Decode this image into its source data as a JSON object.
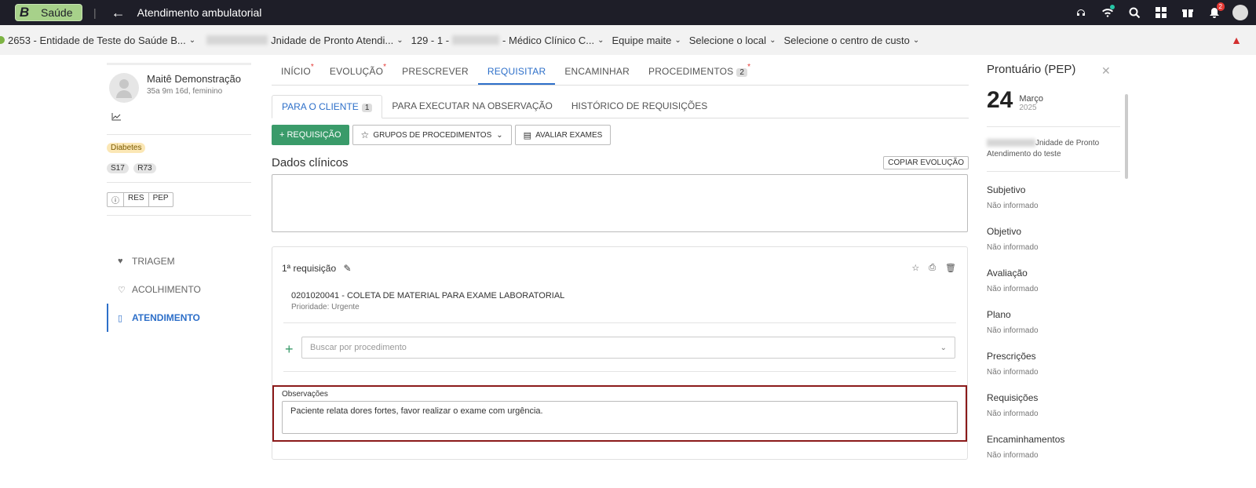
{
  "topbar": {
    "brand_letter": "B",
    "brand_name": "Saúde",
    "separator": "|",
    "title": "Atendimento ambulatorial",
    "notifications_count": "2"
  },
  "context": {
    "entity": "2653 - Entidade de Teste do Saúde B...",
    "unit": "Jnidade de Pronto Atendi...",
    "professional_prefix": "129 - 1 -",
    "professional_suffix": "- Médico Clínico C...",
    "team": "Equipe maite",
    "local": "Selecione o local",
    "cost_center": "Selecione o centro de custo"
  },
  "patient": {
    "name": "Maitê Demonstração",
    "info": "35a 9m 16d, feminino",
    "tag": "Diabetes",
    "codes": [
      "S17",
      "R73"
    ],
    "buttons": [
      "RES",
      "PEP"
    ]
  },
  "nav": {
    "items": [
      {
        "label": "TRIAGEM"
      },
      {
        "label": "ACOLHIMENTO"
      },
      {
        "label": "ATENDIMENTO"
      }
    ]
  },
  "tabs": {
    "main": [
      {
        "label": "INÍCIO",
        "star": "*"
      },
      {
        "label": "EVOLUÇÃO",
        "star": "*"
      },
      {
        "label": "PRESCREVER"
      },
      {
        "label": "REQUISITAR"
      },
      {
        "label": "ENCAMINHAR"
      },
      {
        "label": "PROCEDIMENTOS",
        "count": "2",
        "star": "*"
      }
    ],
    "sub": [
      {
        "label": "PARA O CLIENTE",
        "count": "1"
      },
      {
        "label": "PARA EXECUTAR NA OBSERVAÇÃO"
      },
      {
        "label": "HISTÓRICO DE REQUISIÇÕES"
      }
    ]
  },
  "actions": {
    "requisicao": "+ REQUISIÇÃO",
    "grupos": "GRUPOS DE PROCEDIMENTOS",
    "avaliar": "AVALIAR EXAMES"
  },
  "clinical": {
    "title": "Dados clínicos",
    "copy_button": "COPIAR EVOLUÇÃO"
  },
  "request": {
    "title": "1ª requisição",
    "procedure": "0201020041 - COLETA DE MATERIAL PARA EXAME LABORATORIAL",
    "priority": "Prioridade: Urgente",
    "search_placeholder": "Buscar por procedimento",
    "obs_label": "Observações",
    "obs_text": "Paciente relata dores fortes, favor realizar o exame com urgência."
  },
  "pep": {
    "title": "Prontuário (PEP)",
    "day": "24",
    "month": "Março",
    "year": "2025",
    "unit": "Jnidade de Pronto Atendimento do teste",
    "sections": [
      {
        "title": "Subjetivo",
        "value": "Não informado"
      },
      {
        "title": "Objetivo",
        "value": "Não informado"
      },
      {
        "title": "Avaliação",
        "value": "Não informado"
      },
      {
        "title": "Plano",
        "value": "Não informado"
      },
      {
        "title": "Prescrições",
        "value": "Não informado"
      },
      {
        "title": "Requisições",
        "value": "Não informado"
      },
      {
        "title": "Encaminhamentos",
        "value": "Não informado"
      }
    ]
  }
}
